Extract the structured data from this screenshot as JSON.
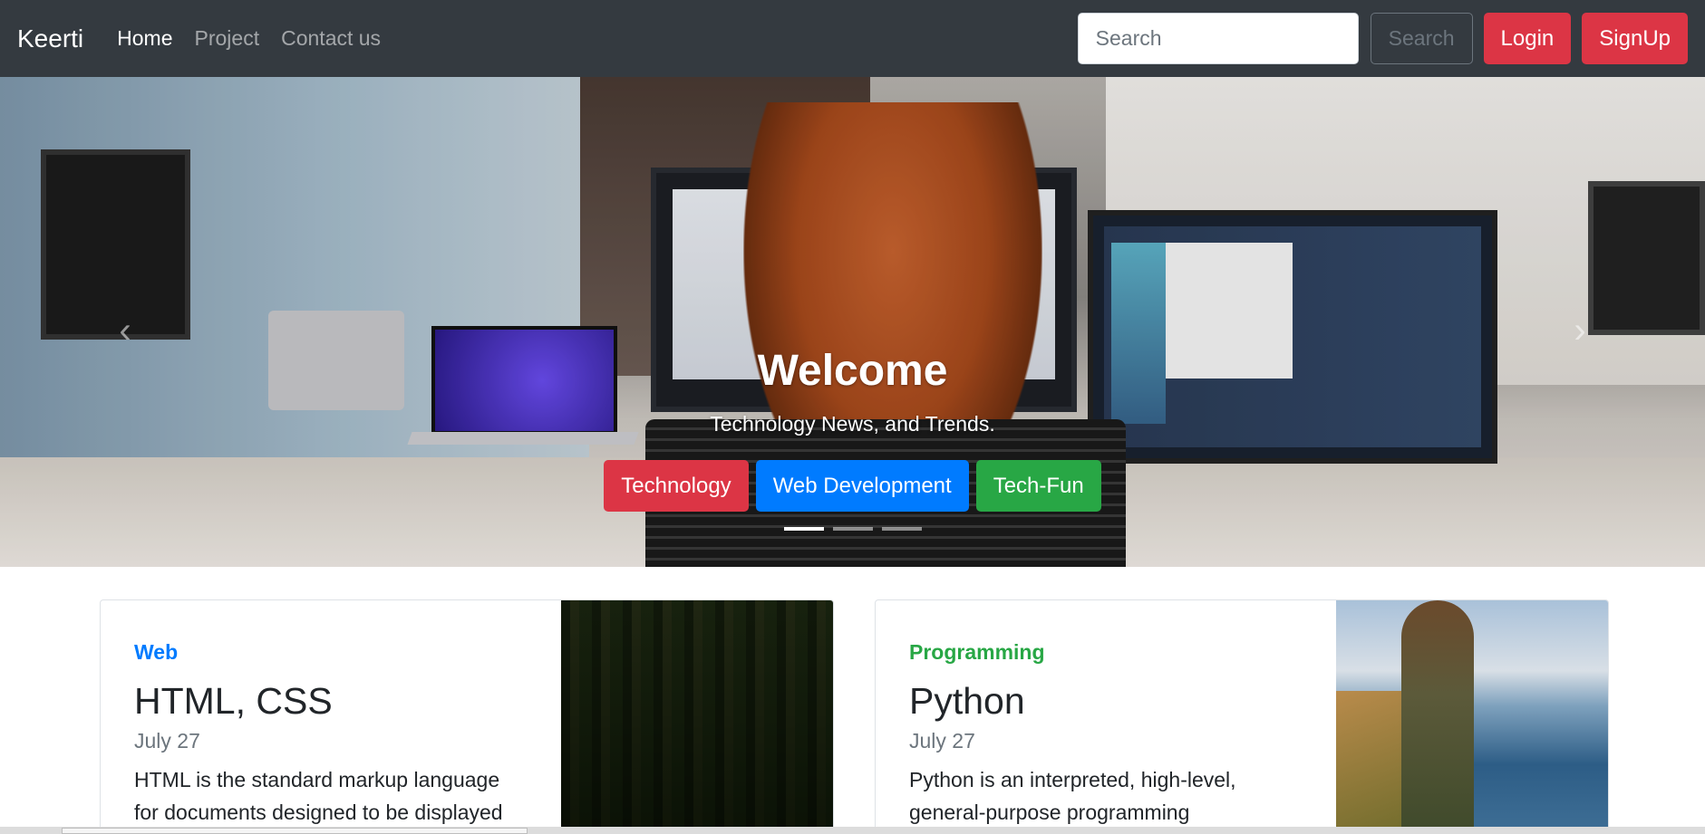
{
  "navbar": {
    "brand": "Keerti",
    "links": [
      {
        "label": "Home",
        "active": true
      },
      {
        "label": "Project",
        "active": false
      },
      {
        "label": "Contact us",
        "active": false
      }
    ],
    "search_placeholder": "Search",
    "search_button": "Search",
    "login_button": "Login",
    "signup_button": "SignUp"
  },
  "hero": {
    "title": "Welcome",
    "subtitle": "Technology News, and Trends.",
    "buttons": [
      "Technology",
      "Web Development",
      "Tech-Fun"
    ],
    "prev_icon": "‹",
    "next_icon": "›",
    "slide_count": 3,
    "active_slide": 1
  },
  "cards": [
    {
      "category": "Web",
      "title": "HTML, CSS",
      "date": "July 27",
      "text": "HTML is the standard markup language for documents designed to be displayed",
      "image": "forest"
    },
    {
      "category": "Programming",
      "title": "Python",
      "date": "July 27",
      "text": "Python is an interpreted, high-level, general-purpose programming",
      "image": "coast"
    }
  ],
  "colors": {
    "navbar_bg": "#343a40",
    "danger": "#dc3545",
    "primary": "#007bff",
    "success": "#28a745"
  }
}
